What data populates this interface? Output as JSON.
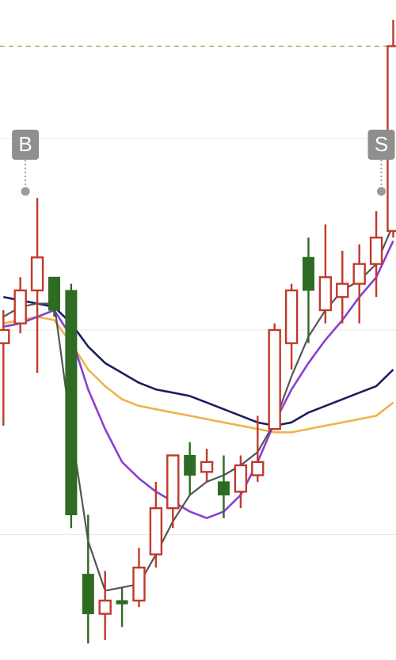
{
  "chart_data": {
    "type": "candlestick",
    "title": "",
    "xlabel": "",
    "ylabel": "",
    "ylim": [
      0,
      100
    ],
    "grid": true,
    "gridlines": [
      19,
      50,
      79
    ],
    "reference_line": {
      "y": 93,
      "style": "dashed",
      "color": "#b89a6a"
    },
    "colors": {
      "up": "#c0392b",
      "down": "#2e6b23",
      "ma_fast": "#555555",
      "ma_purple": "#8a3fd1",
      "ma_navy": "#1a1f5e",
      "ma_orange": "#f0b24a"
    },
    "candles": [
      {
        "x": 1,
        "o": 48.0,
        "h": 53.0,
        "l": 35.5,
        "c": 50.0
      },
      {
        "x": 2,
        "o": 51.0,
        "h": 58.0,
        "l": 49.5,
        "c": 56.0
      },
      {
        "x": 3,
        "o": 56.0,
        "h": 70.0,
        "l": 43.5,
        "c": 61.0
      },
      {
        "x": 4,
        "o": 58.0,
        "h": 58.0,
        "l": 52.0,
        "c": 53.0
      },
      {
        "x": 5,
        "o": 56.0,
        "h": 57.0,
        "l": 20.0,
        "c": 22.0
      },
      {
        "x": 6,
        "o": 13.0,
        "h": 22.0,
        "l": 2.5,
        "c": 7.0
      },
      {
        "x": 7,
        "o": 7.0,
        "h": 13.5,
        "l": 3.0,
        "c": 9.0
      },
      {
        "x": 8,
        "o": 9.0,
        "h": 11.0,
        "l": 5.0,
        "c": 8.5
      },
      {
        "x": 9,
        "o": 9.0,
        "h": 17.0,
        "l": 8.0,
        "c": 14.0
      },
      {
        "x": 10,
        "o": 16.0,
        "h": 27.0,
        "l": 14.0,
        "c": 23.0
      },
      {
        "x": 11,
        "o": 23.0,
        "h": 31.0,
        "l": 20.0,
        "c": 31.0
      },
      {
        "x": 12,
        "o": 31.0,
        "h": 33.0,
        "l": 25.0,
        "c": 28.0
      },
      {
        "x": 13,
        "o": 28.5,
        "h": 32.0,
        "l": 27.0,
        "c": 30.0
      },
      {
        "x": 14,
        "o": 27.0,
        "h": 31.0,
        "l": 21.5,
        "c": 25.0
      },
      {
        "x": 15,
        "o": 25.5,
        "h": 31.0,
        "l": 23.0,
        "c": 29.5
      },
      {
        "x": 16,
        "o": 28.0,
        "h": 37.0,
        "l": 27.0,
        "c": 30.0
      },
      {
        "x": 17,
        "o": 35.0,
        "h": 51.0,
        "l": 35.0,
        "c": 50.0
      },
      {
        "x": 18,
        "o": 48.0,
        "h": 57.0,
        "l": 44.0,
        "c": 56.0
      },
      {
        "x": 19,
        "o": 61.0,
        "h": 64.0,
        "l": 48.0,
        "c": 56.0
      },
      {
        "x": 20,
        "o": 53.0,
        "h": 66.0,
        "l": 51.0,
        "c": 58.0
      },
      {
        "x": 21,
        "o": 55.0,
        "h": 62.0,
        "l": 51.0,
        "c": 57.0
      },
      {
        "x": 22,
        "o": 57.0,
        "h": 63.0,
        "l": 51.0,
        "c": 60.0
      },
      {
        "x": 23,
        "o": 60.0,
        "h": 68.0,
        "l": 55.0,
        "c": 64.0
      },
      {
        "x": 24,
        "o": 65.0,
        "h": 97.0,
        "l": 64.0,
        "c": 93.0
      }
    ],
    "series": [
      {
        "key": "ma_fast",
        "values": [
          52.0,
          53.5,
          54.0,
          54.0,
          35.0,
          18.0,
          10.5,
          11.0,
          11.5,
          16.0,
          21.0,
          25.0,
          27.0,
          28.0,
          29.5,
          31.5,
          36.0,
          43.0,
          49.0,
          53.0,
          56.0,
          57.5,
          60.0,
          66.0
        ]
      },
      {
        "key": "ma_purple",
        "values": [
          50.5,
          51.0,
          52.0,
          53.0,
          49.0,
          41.0,
          35.0,
          30.0,
          27.5,
          25.5,
          24.0,
          22.5,
          21.5,
          22.5,
          25.0,
          30.0,
          36.0,
          41.0,
          45.0,
          48.5,
          51.5,
          55.0,
          58.0,
          63.5
        ]
      },
      {
        "key": "ma_navy",
        "values": [
          55.0,
          54.5,
          54.0,
          53.5,
          51.0,
          47.5,
          45.0,
          43.5,
          42.0,
          41.0,
          40.5,
          40.0,
          39.0,
          38.0,
          37.0,
          36.0,
          35.5,
          36.0,
          37.5,
          38.5,
          39.5,
          40.5,
          41.5,
          44.0
        ]
      },
      {
        "key": "ma_orange",
        "values": [
          51.0,
          51.5,
          52.0,
          51.5,
          48.0,
          44.0,
          41.5,
          39.5,
          38.5,
          38.0,
          37.5,
          37.0,
          36.5,
          36.0,
          35.5,
          35.0,
          34.5,
          34.5,
          35.0,
          35.5,
          36.0,
          36.5,
          37.0,
          39.0
        ]
      }
    ],
    "markers": [
      {
        "label": "B",
        "x": 2.3,
        "y": 71.0
      },
      {
        "label": "S",
        "x": 23.3,
        "y": 71.0
      }
    ]
  }
}
